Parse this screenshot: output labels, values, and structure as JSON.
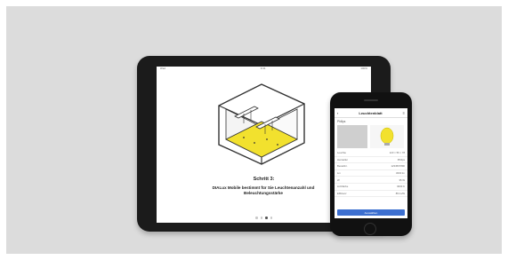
{
  "tablet": {
    "status_left": "iPad",
    "status_center": "9:41",
    "status_right": "100%",
    "step_title": "Schritt 3:",
    "step_description": "DIALux Mobile bestimmt für Sie Leuchtenanzahl und Beleuchtungsstärke",
    "page_dots": 4,
    "active_dot": 2,
    "accent_yellow": "#f2e12e",
    "check_green": "#3cb84a"
  },
  "phone": {
    "header_title": "Leuchtenblatt",
    "subtitle": "Philips",
    "rows": [
      {
        "label": "Leuchte",
        "value": "123 × 56 × 78"
      },
      {
        "label": "Hersteller",
        "value": "Philips"
      },
      {
        "label": "Bestellnr.",
        "value": "1234567890"
      },
      {
        "label": "Lm",
        "value": "3000 lm"
      },
      {
        "label": "W",
        "value": "35 W"
      },
      {
        "label": "Lichtfarbe",
        "value": "3000 K"
      },
      {
        "label": "Effizienz",
        "value": "85 lm/W"
      }
    ],
    "button_label": "Auswählen",
    "accent_blue": "#3c6fd0"
  }
}
